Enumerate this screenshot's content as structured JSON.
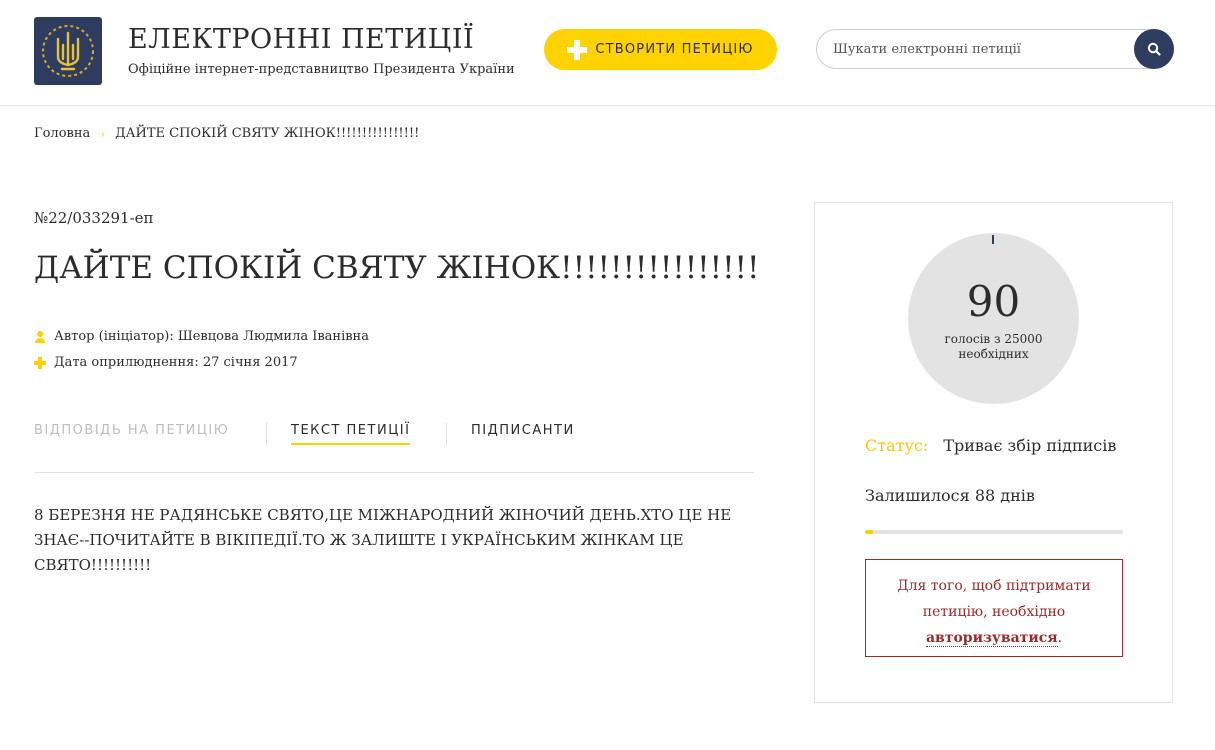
{
  "header": {
    "site_title": "ЕЛЕКТРОННІ ПЕТИЦІЇ",
    "site_subtitle": "Офіційне інтернет-представництво Президента України",
    "create_button": "СТВОРИТИ ПЕТИЦІЮ",
    "search_placeholder": "Шукати електронні петиції",
    "logo_icon": "trident-icon",
    "search_icon": "search-icon"
  },
  "breadcrumb": {
    "home": "Головна",
    "separator": "›",
    "current": "ДАЙТЕ СПОКІЙ СВЯТУ ЖІНОК!!!!!!!!!!!!!!!!"
  },
  "petition": {
    "number": "№22/033291-еп",
    "title": "ДАЙТЕ СПОКІЙ СВЯТУ ЖІНОК!!!!!!!!!!!!!!!!",
    "author": "Автор (ініціатор): Шевцова Людмила Іванівна",
    "date": "Дата оприлюднення: 27 січня 2017",
    "text": "8 БЕРЕЗНЯ НЕ РАДЯНСЬКЕ СВЯТО,ЦЕ МІЖНАРОДНИЙ ЖІНОЧИЙ ДЕНЬ.ХТО ЦЕ НЕ ЗНАЄ--ПОЧИТАЙТЕ В ВІКІПЕДІЇ.ТО Ж ЗАЛИШТЕ І УКРАЇНСЬКИМ ЖІНКАМ ЦЕ СВЯТО!!!!!!!!!!"
  },
  "tabs": [
    {
      "label": "ВІДПОВІДЬ НА ПЕТИЦІЮ",
      "state": "disabled"
    },
    {
      "label": "ТЕКСТ ПЕТИЦІЇ",
      "state": "active"
    },
    {
      "label": "ПІДПИСАНТИ",
      "state": "normal"
    }
  ],
  "sidebar": {
    "votes_count": "90",
    "votes_caption": "голосів з 25000 необхідних",
    "votes_fraction": 0.0036,
    "status_label": "Статус:",
    "status_value": "Триває збір підписів",
    "remaining": "Залишилося 88 днів",
    "progress_fraction": 0.03,
    "login_text_before": "Для того, щоб підтримати петицію, необхідно",
    "login_link": "авторизуватися",
    "login_text_after": "."
  },
  "colors": {
    "accent_yellow": "#ffd200",
    "navy": "#2e3d5f",
    "error_red": "#9b2b2b"
  }
}
